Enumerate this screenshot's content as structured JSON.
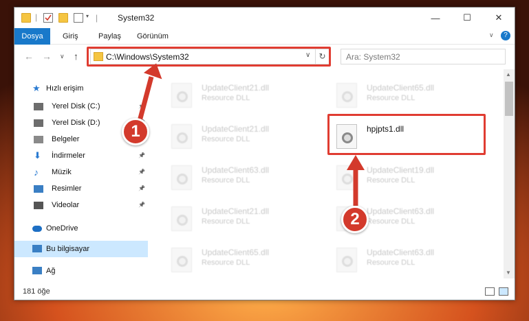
{
  "window": {
    "title": "System32"
  },
  "ribbon": {
    "tabs": [
      "Dosya",
      "Giriş",
      "Paylaş",
      "Görünüm"
    ]
  },
  "address": {
    "path": "C:\\Windows\\System32",
    "search_placeholder": "Ara: System32"
  },
  "nav": {
    "items": [
      {
        "label": "Hızlı erişim",
        "icon": "star-icon",
        "pinned": false
      },
      {
        "label": "Yerel Disk (C:)",
        "icon": "drive-icon",
        "pinned": true
      },
      {
        "label": "Yerel Disk (D:)",
        "icon": "drive-icon",
        "pinned": true
      },
      {
        "label": "Belgeler",
        "icon": "documents-icon",
        "pinned": true
      },
      {
        "label": "İndirmeler",
        "icon": "download-icon",
        "pinned": true
      },
      {
        "label": "Müzik",
        "icon": "music-icon",
        "pinned": true
      },
      {
        "label": "Resimler",
        "icon": "pictures-icon",
        "pinned": true
      },
      {
        "label": "Videolar",
        "icon": "videos-icon",
        "pinned": true
      },
      {
        "label": "OneDrive",
        "icon": "cloud-icon",
        "pinned": false
      },
      {
        "label": "Bu bilgisayar",
        "icon": "computer-icon",
        "pinned": false,
        "selected": true
      },
      {
        "label": "Ağ",
        "icon": "network-icon",
        "pinned": false
      }
    ]
  },
  "files": [
    {
      "name": "UpdateClient21.dll",
      "type": "Resource DLL"
    },
    {
      "name": "UpdateClient65.dll",
      "type": "Resource DLL"
    },
    {
      "name": "UpdateClient21.dll",
      "type": "Resource DLL"
    },
    {
      "name": "hpjpts1.dll",
      "type": ""
    },
    {
      "name": "UpdateClient63.dll",
      "type": "Resource DLL"
    },
    {
      "name": "UpdateClient19.dll",
      "type": "Resource DLL"
    },
    {
      "name": "UpdateClient21.dll",
      "type": "Resource DLL"
    },
    {
      "name": "UpdateClient63.dll",
      "type": "Resource DLL"
    },
    {
      "name": "UpdateClient65.dll",
      "type": "Resource DLL"
    },
    {
      "name": "UpdateClient63.dll",
      "type": "Resource DLL"
    }
  ],
  "status": {
    "count": "181 öğe"
  },
  "annotations": {
    "badge1": "1",
    "badge2": "2"
  },
  "colors": {
    "accent": "#1979ca",
    "highlight": "#e03c31",
    "badge": "#d33a2c"
  }
}
